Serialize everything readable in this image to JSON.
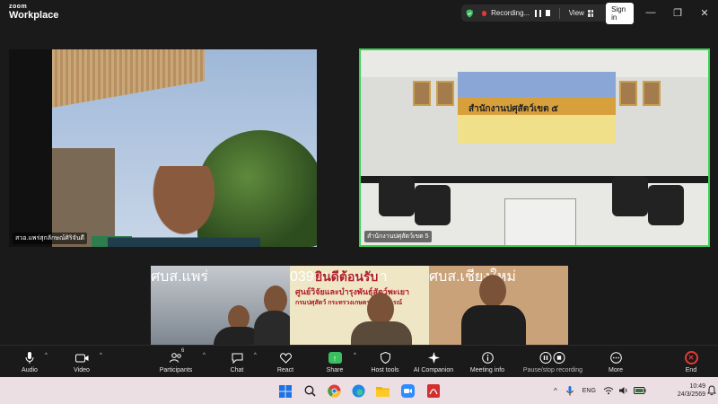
{
  "window": {
    "brand_line1": "zoom",
    "brand_line2": "Workplace",
    "recording_label": "Recording...",
    "view_label": "View",
    "signin_label": "Sign in",
    "minimize": "—",
    "restore": "❐",
    "close": "✕"
  },
  "videos": [
    {
      "name": "สวอ.แพร่สุกลักษณ์ศิริจันดี"
    },
    {
      "name": "สำนักงานปศุสัตว์เขต 5",
      "banner_text": "สำนักงานปศุสัตว์เขต ๕"
    }
  ],
  "strip": [
    {
      "name": "ศบส.แพร่"
    },
    {
      "name": "039 ศบส.พะเยา",
      "sign_line1": "ยินดีต้อนรับ",
      "sign_line2": "ศูนย์วิจัยและบำรุงพันธุ์สัตว์พะเยา",
      "sign_line3": "กรมปศุสัตว์ กระทรวงเกษตรและสหกรณ์"
    },
    {
      "name": "ศบส.เชียงใหม่"
    }
  ],
  "toolbar": {
    "audio": "Audio",
    "video": "Video",
    "participants": "Participants",
    "participants_count": "6",
    "chat": "Chat",
    "react": "React",
    "share": "Share",
    "host_tools": "Host tools",
    "ai_companion": "AI Companion",
    "meeting_info": "Meeting info",
    "recording": "Pause/stop recording",
    "more": "More",
    "end": "End"
  },
  "taskbar": {
    "lang": "ENG",
    "time": "10:49",
    "date": "24/3/2569"
  },
  "colors": {
    "active_speaker": "#39d353",
    "share_green": "#3ac060",
    "end_red": "#e53935"
  }
}
